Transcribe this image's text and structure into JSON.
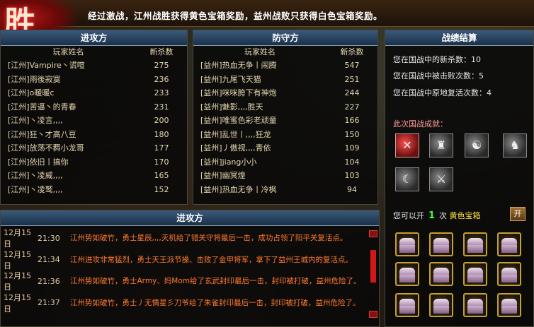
{
  "banner": {
    "emblem_char": "胜",
    "message": "经过激战，江州战胜获得黄色宝箱奖励，益州战败只获得白色宝箱奖励。"
  },
  "attack": {
    "title": "进攻方",
    "col_name": "玩家姓名",
    "col_kill": "新杀数",
    "rows": [
      {
        "name": "[江州]Vampire丶谎喧",
        "kills": "275"
      },
      {
        "name": "[江州]雨後寂寞",
        "kills": "236"
      },
      {
        "name": "[江州]o暖暖c",
        "kills": "233"
      },
      {
        "name": "[江州]苦逼丶的青春",
        "kills": "231"
      },
      {
        "name": "[江州]丶凌言,,,,",
        "kills": "200"
      },
      {
        "name": "[江州]狂丶才高八豆",
        "kills": "180"
      },
      {
        "name": "[江州]放荡不羁小龙哥",
        "kills": "177"
      },
      {
        "name": "[江州]依旧丨搞你",
        "kills": "170"
      },
      {
        "name": "[江州]丶凌威,,,,",
        "kills": "165"
      },
      {
        "name": "[江州]丶凌鹫,,,,",
        "kills": "152"
      }
    ]
  },
  "defense": {
    "title": "防守方",
    "col_name": "玩家姓名",
    "col_kill": "新杀数",
    "rows": [
      {
        "name": "[益州]热血无争丨闹腾",
        "kills": "547"
      },
      {
        "name": "[益州]九尾飞天猫",
        "kills": "251"
      },
      {
        "name": "[益州]咪咪胯下有神炮",
        "kills": "244"
      },
      {
        "name": "[益州]魅影,,,,胜天",
        "kills": "227"
      },
      {
        "name": "[益州]唯蜜色彩老顽童",
        "kills": "166"
      },
      {
        "name": "[益州]乱世丨,,,,狂龙",
        "kills": "150"
      },
      {
        "name": "[益州]丿傲视,,,,青依",
        "kills": "109"
      },
      {
        "name": "[益州]jiang小小",
        "kills": "104"
      },
      {
        "name": "[益州]幽冥煌",
        "kills": "103"
      },
      {
        "name": "[益州]热血无争丨冷枫",
        "kills": "94"
      }
    ]
  },
  "summary": {
    "title": "战绩结算",
    "new_kills": "您在国战中的新杀数：10",
    "defeated": "您在国战中被击败次数：5",
    "revives": "您在国战中原地复活次数：4",
    "achievements_title": "此次国战成就：",
    "open_prefix": "您可以开",
    "open_count": "1",
    "open_suffix": "次",
    "chest_type": "黄色宝箱",
    "open_button": "开",
    "colors": {
      "accent_green": "#40ff40",
      "chest_yellow": "#ffe040"
    }
  },
  "log": {
    "title": "进攻方",
    "entries": [
      {
        "date": "12月15日",
        "time": "21:30",
        "text": "江州势如破竹，勇士星辰,,,,灭机给了错关守将最后一击，成功占领了阳平关复活点。"
      },
      {
        "date": "12月15日",
        "time": "21:34",
        "text": "江州进攻非常猛烈，勇士天王派节操、击败了金甲将军，拿下了益州王城内的复活点。"
      },
      {
        "date": "12月15日",
        "time": "21:36",
        "text": "江州势如破竹，勇士Army、妈Mom给了玄武封印最后一击，封印被打破，益州危险了。"
      },
      {
        "date": "12月15日",
        "time": "21:37",
        "text": "江州势如破竹，勇士丿无情星彡刀爷给了朱雀封印最后一击，封印被打破，益州危险了。"
      }
    ]
  }
}
